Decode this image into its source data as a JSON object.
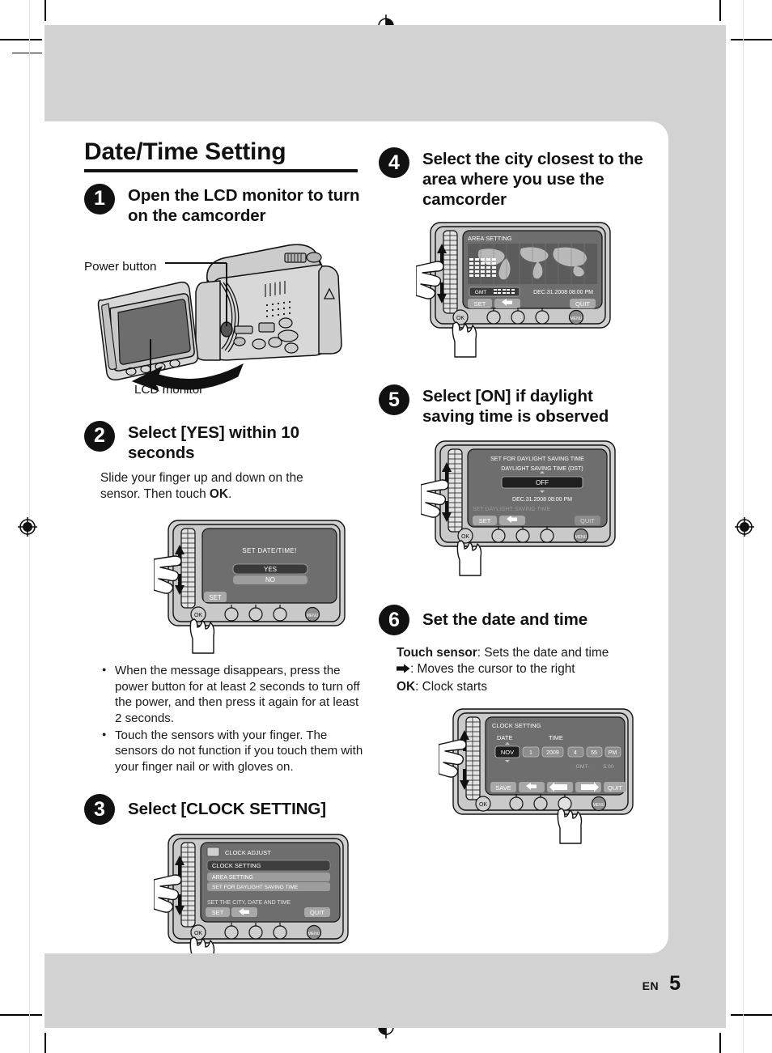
{
  "page": {
    "title": "Date/Time Setting",
    "footer_lang": "EN",
    "footer_page": "5",
    "bg_color": "#d2d2d2",
    "panel_color": "#ffffff",
    "ink_color": "#111111"
  },
  "steps": [
    {
      "num": "1",
      "title": "Open the LCD monitor to turn on the camcorder",
      "labels": {
        "power": "Power button",
        "lcd": "LCD monitor"
      }
    },
    {
      "num": "2",
      "title": "Select [YES] within 10 seconds",
      "body_1": "Slide your finger up and down on the",
      "body_2": "sensor. Then touch ",
      "body_2_bold": "OK",
      "body_2_end": ".",
      "notes": [
        "When the message disappears, press the power button for at least 2 seconds to turn off the power, and then press it again for at least 2 seconds.",
        "Touch the sensors with your finger. The sensors do not function if you touch them with your finger nail or with gloves on."
      ],
      "screen": {
        "message": "SET DATE/TIME!",
        "option_selected": "YES",
        "option_other": "NO",
        "btn_set": "SET",
        "btn_ok": "OK",
        "btn_menu": "MENU"
      }
    },
    {
      "num": "3",
      "title": "Select [CLOCK SETTING]",
      "screen": {
        "header": "CLOCK ADJUST",
        "item_selected": "CLOCK SETTING",
        "item_2": "AREA SETTING",
        "item_3": "SET FOR DAYLIGHT SAVING TIME",
        "hint": "SET THE CITY, DATE AND TIME",
        "btn_set": "SET",
        "btn_back": "back-arrow",
        "btn_quit": "QUIT",
        "btn_ok": "OK",
        "btn_menu": "MENU"
      }
    },
    {
      "num": "4",
      "title": "Select the city closest to the area where you use the camcorder",
      "screen": {
        "header": "AREA SETTING",
        "gmt_label": "GMT",
        "datetime": "DEC.31.2008  08:00 PM",
        "btn_set": "SET",
        "btn_back": "back-arrow",
        "btn_quit": "QUIT",
        "btn_ok": "OK",
        "btn_menu": "MENU"
      }
    },
    {
      "num": "5",
      "title": "Select [ON] if daylight saving time is observed",
      "screen": {
        "header": "SET FOR DAYLIGHT SAVING TIME",
        "subheader": "DAYLIGHT SAVING TIME (DST)",
        "value": "OFF",
        "datetime": "DEC.31.2008  08:00 PM",
        "hint": "SET DAYLIGHT SAVING TIME",
        "btn_set": "SET",
        "btn_back": "back-arrow",
        "btn_quit": "QUIT",
        "btn_ok": "OK",
        "btn_menu": "MENU"
      }
    },
    {
      "num": "6",
      "title": "Set the date and time",
      "desc_1_bold": "Touch sensor",
      "desc_1": ": Sets the date and time",
      "desc_2": ": Moves the cursor to the right",
      "desc_3_bold": "OK",
      "desc_3": ": Clock starts",
      "screen": {
        "header": "CLOCK SETTING",
        "col_date": "DATE",
        "col_time": "TIME",
        "month": "NOV",
        "day": "1",
        "year": "2009",
        "hour": "4",
        "minute": "55",
        "ampm": "PM",
        "gmt_label": "GMT-",
        "gmt_value": "5:00",
        "btn_save": "SAVE",
        "btn_back": "back-arrow",
        "btn_left": "left-arrow",
        "btn_right": "right-arrow",
        "btn_quit": "QUIT",
        "btn_ok": "OK",
        "btn_menu": "MENU"
      }
    }
  ]
}
